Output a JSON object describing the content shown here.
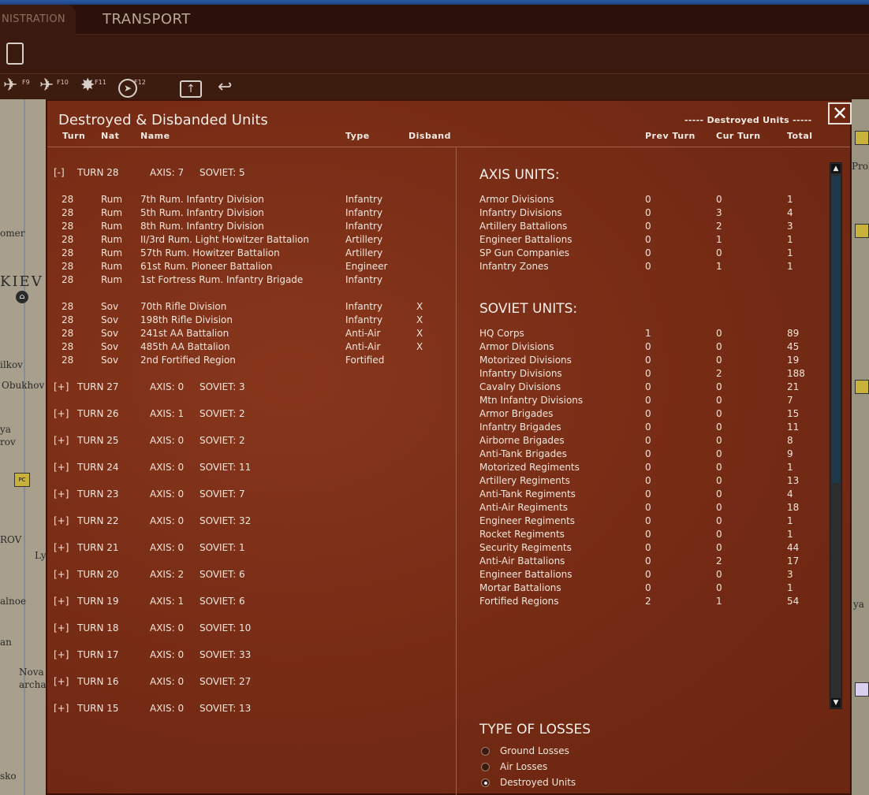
{
  "tabs": {
    "admin": "NISTRATION",
    "transport": "TRANSPORT"
  },
  "toolbar": {
    "f9": "F9",
    "f10": "F10",
    "f11": "F11",
    "f12": "F12"
  },
  "map_labels": [
    "omer",
    "KIEV",
    "ilkov",
    "Obukhov",
    "ya",
    "rov",
    "ROV",
    "Ly",
    "alnoe",
    "an",
    "Nova",
    "archa",
    "sko",
    "Prok",
    "ya"
  ],
  "counter_label": "PC",
  "dialog": {
    "title": "Destroyed & Disbanded Units",
    "right_title": "----- Destroyed Units -----",
    "close_label": "✕",
    "headers": {
      "turn": "Turn",
      "nat": "Nat",
      "name": "Name",
      "type": "Type",
      "disband": "Disband",
      "prev": "Prev Turn",
      "cur": "Cur Turn",
      "total": "Total"
    }
  },
  "expanded_turn": {
    "toggle": "[-]",
    "turn": "TURN 28",
    "axis": "AXIS: 7",
    "soviet": "SOVIET: 5"
  },
  "axis_rows": [
    {
      "turn": "28",
      "nat": "Rum",
      "name": "7th Rum. Infantry Division",
      "type": "Infantry",
      "disband": ""
    },
    {
      "turn": "28",
      "nat": "Rum",
      "name": "5th Rum. Infantry Division",
      "type": "Infantry",
      "disband": ""
    },
    {
      "turn": "28",
      "nat": "Rum",
      "name": "8th Rum. Infantry Division",
      "type": "Infantry",
      "disband": ""
    },
    {
      "turn": "28",
      "nat": "Rum",
      "name": "II/3rd Rum. Light Howitzer Battalion",
      "type": "Artillery",
      "disband": ""
    },
    {
      "turn": "28",
      "nat": "Rum",
      "name": "57th Rum. Howitzer Battalion",
      "type": "Artillery",
      "disband": ""
    },
    {
      "turn": "28",
      "nat": "Rum",
      "name": "61st Rum. Pioneer Battalion",
      "type": "Engineer",
      "disband": ""
    },
    {
      "turn": "28",
      "nat": "Rum",
      "name": "1st Fortress Rum. Infantry Brigade",
      "type": "Infantry",
      "disband": ""
    }
  ],
  "soviet_rows": [
    {
      "turn": "28",
      "nat": "Sov",
      "name": "70th Rifle Division",
      "type": "Infantry",
      "disband": "X"
    },
    {
      "turn": "28",
      "nat": "Sov",
      "name": "198th Rifle Division",
      "type": "Infantry",
      "disband": "X"
    },
    {
      "turn": "28",
      "nat": "Sov",
      "name": "241st AA Battalion",
      "type": "Anti-Air",
      "disband": "X"
    },
    {
      "turn": "28",
      "nat": "Sov",
      "name": "485th AA Battalion",
      "type": "Anti-Air",
      "disband": "X"
    },
    {
      "turn": "28",
      "nat": "Sov",
      "name": "2nd Fortified Region",
      "type": "Fortified",
      "disband": ""
    }
  ],
  "collapsed_turns": [
    {
      "toggle": "[+]",
      "turn": "TURN 27",
      "axis": "AXIS: 0",
      "soviet": "SOVIET: 3"
    },
    {
      "toggle": "[+]",
      "turn": "TURN 26",
      "axis": "AXIS: 1",
      "soviet": "SOVIET: 2"
    },
    {
      "toggle": "[+]",
      "turn": "TURN 25",
      "axis": "AXIS: 0",
      "soviet": "SOVIET: 2"
    },
    {
      "toggle": "[+]",
      "turn": "TURN 24",
      "axis": "AXIS: 0",
      "soviet": "SOVIET: 11"
    },
    {
      "toggle": "[+]",
      "turn": "TURN 23",
      "axis": "AXIS: 0",
      "soviet": "SOVIET: 7"
    },
    {
      "toggle": "[+]",
      "turn": "TURN 22",
      "axis": "AXIS: 0",
      "soviet": "SOVIET: 32"
    },
    {
      "toggle": "[+]",
      "turn": "TURN 21",
      "axis": "AXIS: 0",
      "soviet": "SOVIET: 1"
    },
    {
      "toggle": "[+]",
      "turn": "TURN 20",
      "axis": "AXIS: 2",
      "soviet": "SOVIET: 6"
    },
    {
      "toggle": "[+]",
      "turn": "TURN 19",
      "axis": "AXIS: 1",
      "soviet": "SOVIET: 6"
    },
    {
      "toggle": "[+]",
      "turn": "TURN 18",
      "axis": "AXIS: 0",
      "soviet": "SOVIET: 10"
    },
    {
      "toggle": "[+]",
      "turn": "TURN 17",
      "axis": "AXIS: 0",
      "soviet": "SOVIET: 33"
    },
    {
      "toggle": "[+]",
      "turn": "TURN 16",
      "axis": "AXIS: 0",
      "soviet": "SOVIET: 27"
    },
    {
      "toggle": "[+]",
      "turn": "TURN 15",
      "axis": "AXIS: 0",
      "soviet": "SOVIET: 13"
    }
  ],
  "axis_summary": {
    "title": "AXIS UNITS:",
    "rows": [
      {
        "label": "Armor Divisions",
        "prev": "0",
        "cur": "0",
        "total": "1"
      },
      {
        "label": "Infantry Divisions",
        "prev": "0",
        "cur": "3",
        "total": "4"
      },
      {
        "label": "Artillery Battalions",
        "prev": "0",
        "cur": "2",
        "total": "3"
      },
      {
        "label": "Engineer Battalions",
        "prev": "0",
        "cur": "1",
        "total": "1"
      },
      {
        "label": "SP Gun Companies",
        "prev": "0",
        "cur": "0",
        "total": "1"
      },
      {
        "label": "Infantry Zones",
        "prev": "0",
        "cur": "1",
        "total": "1"
      }
    ]
  },
  "soviet_summary": {
    "title": "SOVIET UNITS:",
    "rows": [
      {
        "label": "HQ Corps",
        "prev": "1",
        "cur": "0",
        "total": "89"
      },
      {
        "label": "Armor Divisions",
        "prev": "0",
        "cur": "0",
        "total": "45"
      },
      {
        "label": "Motorized Divisions",
        "prev": "0",
        "cur": "0",
        "total": "19"
      },
      {
        "label": "Infantry Divisions",
        "prev": "0",
        "cur": "2",
        "total": "188"
      },
      {
        "label": "Cavalry Divisions",
        "prev": "0",
        "cur": "0",
        "total": "21"
      },
      {
        "label": "Mtn Infantry Divisions",
        "prev": "0",
        "cur": "0",
        "total": "7"
      },
      {
        "label": "Armor Brigades",
        "prev": "0",
        "cur": "0",
        "total": "15"
      },
      {
        "label": "Infantry Brigades",
        "prev": "0",
        "cur": "0",
        "total": "11"
      },
      {
        "label": "Airborne Brigades",
        "prev": "0",
        "cur": "0",
        "total": "8"
      },
      {
        "label": "Anti-Tank Brigades",
        "prev": "0",
        "cur": "0",
        "total": "9"
      },
      {
        "label": "Motorized Regiments",
        "prev": "0",
        "cur": "0",
        "total": "1"
      },
      {
        "label": "Artillery Regiments",
        "prev": "0",
        "cur": "0",
        "total": "13"
      },
      {
        "label": "Anti-Tank Regiments",
        "prev": "0",
        "cur": "0",
        "total": "4"
      },
      {
        "label": "Anti-Air Regiments",
        "prev": "0",
        "cur": "0",
        "total": "18"
      },
      {
        "label": "Engineer Regiments",
        "prev": "0",
        "cur": "0",
        "total": "1"
      },
      {
        "label": "Rocket Regiments",
        "prev": "0",
        "cur": "0",
        "total": "1"
      },
      {
        "label": "Security Regiments",
        "prev": "0",
        "cur": "0",
        "total": "44"
      },
      {
        "label": "Anti-Air Battalions",
        "prev": "0",
        "cur": "2",
        "total": "17"
      },
      {
        "label": "Engineer Battalions",
        "prev": "0",
        "cur": "0",
        "total": "3"
      },
      {
        "label": "Mortar Battalions",
        "prev": "0",
        "cur": "0",
        "total": "1"
      },
      {
        "label": "Fortified Regions",
        "prev": "2",
        "cur": "1",
        "total": "54"
      }
    ]
  },
  "losses": {
    "title": "TYPE OF LOSSES",
    "options": [
      {
        "label": "Ground Losses",
        "selected": false
      },
      {
        "label": "Air Losses",
        "selected": false
      },
      {
        "label": "Destroyed Units",
        "selected": true
      }
    ]
  },
  "scroll": {
    "up": "▲",
    "down": "▼"
  }
}
